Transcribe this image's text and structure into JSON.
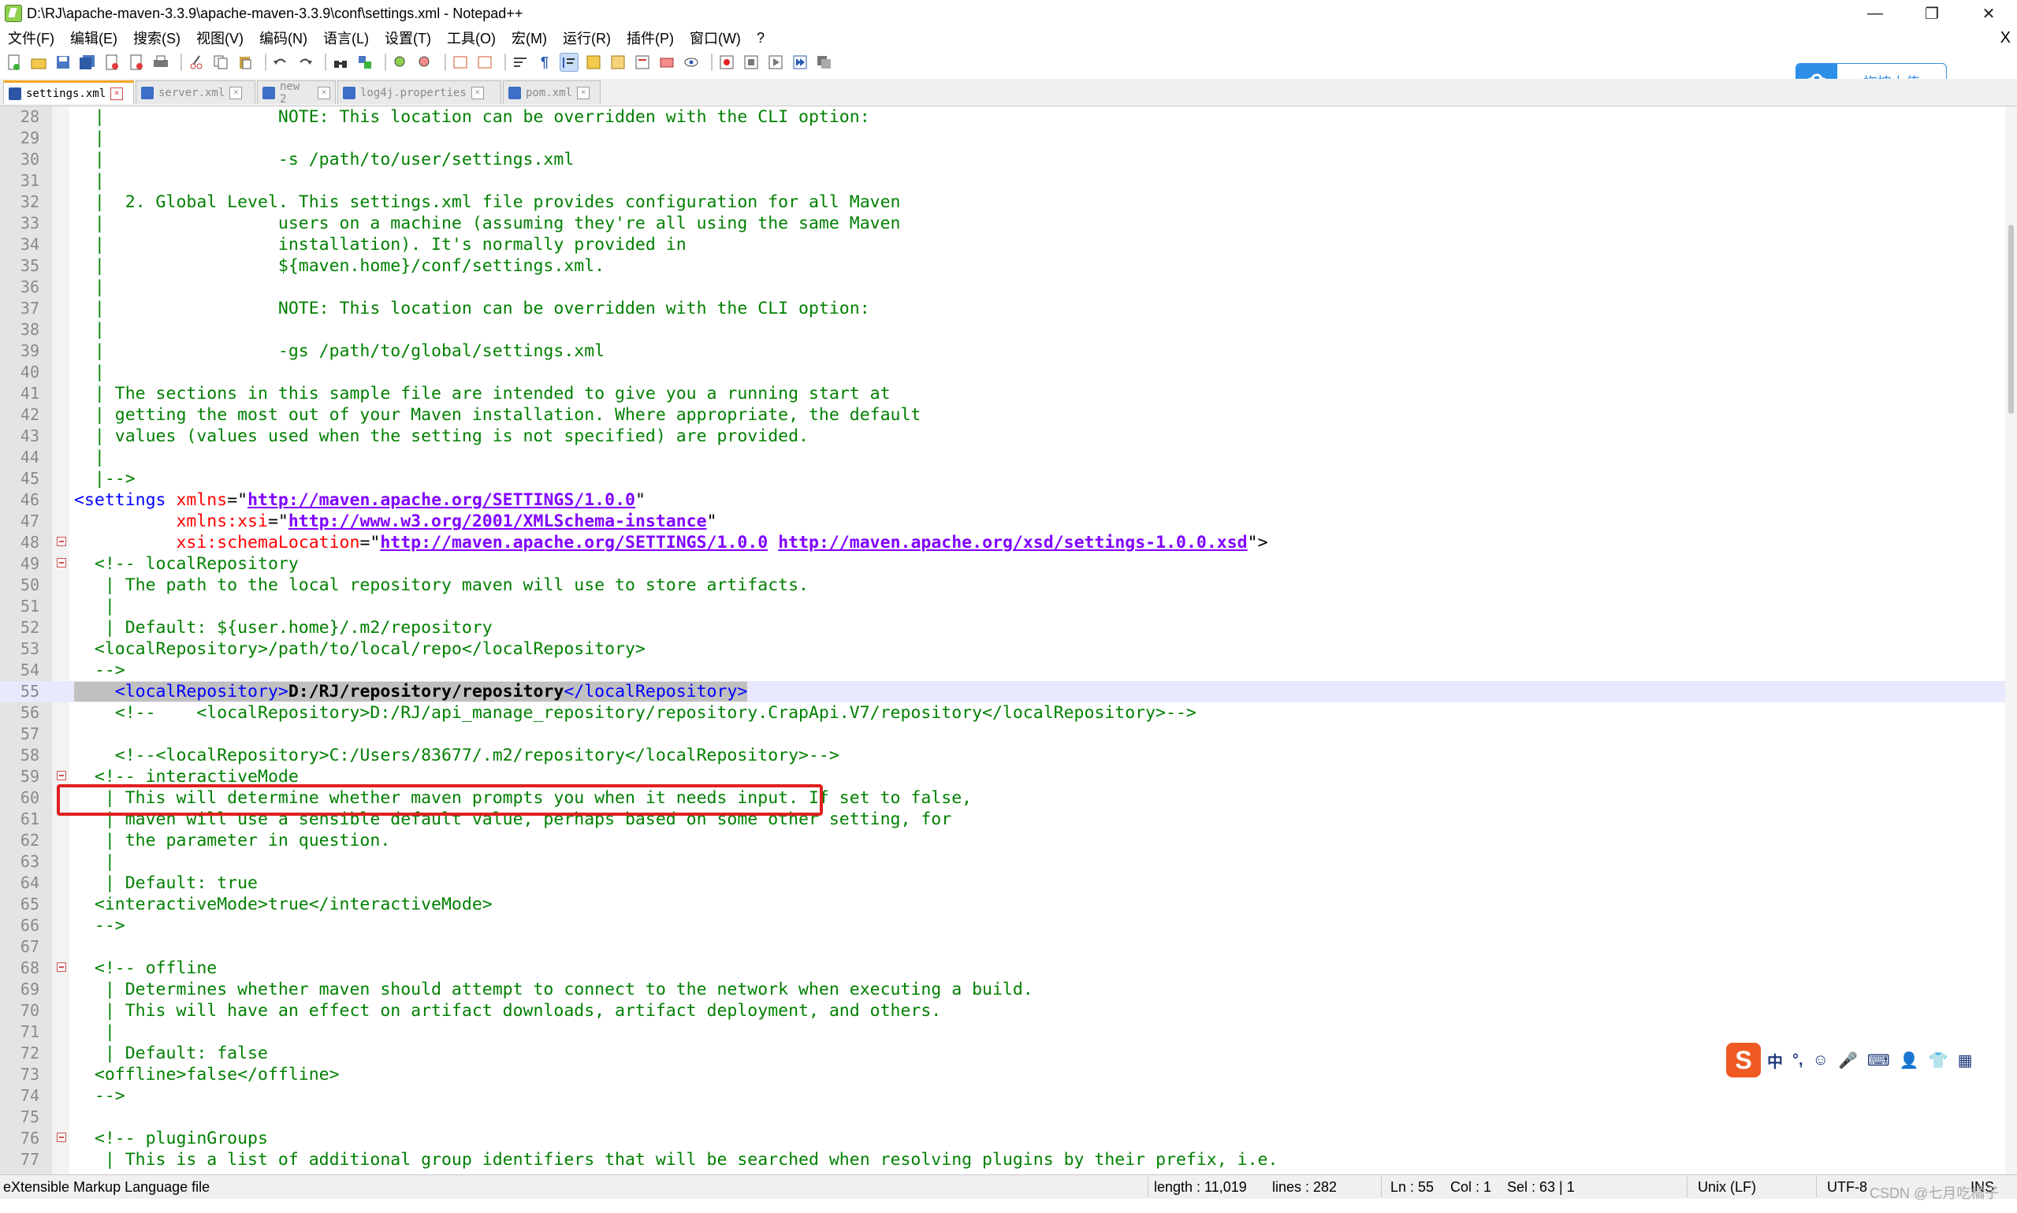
{
  "window": {
    "title": "D:\\RJ\\apache-maven-3.3.9\\apache-maven-3.3.9\\conf\\settings.xml - Notepad++",
    "minimize": "—",
    "maximize": "❐",
    "close": "✕"
  },
  "menu": {
    "items": [
      "文件(F)",
      "编辑(E)",
      "搜索(S)",
      "视图(V)",
      "编码(N)",
      "语言(L)",
      "设置(T)",
      "工具(O)",
      "宏(M)",
      "运行(R)",
      "插件(P)",
      "窗口(W)",
      "?"
    ],
    "close": "X"
  },
  "upload": {
    "label": "拖拽上传"
  },
  "tabs": [
    {
      "label": "settings.xml",
      "active": true
    },
    {
      "label": "server.xml",
      "active": false
    },
    {
      "label": "new 2",
      "active": false
    },
    {
      "label": "log4j.properties",
      "active": false
    },
    {
      "label": "pom.xml",
      "active": false
    }
  ],
  "editor": {
    "lines": [
      {
        "n": "28",
        "text": "  |                 NOTE: This location can be overridden with the CLI option:"
      },
      {
        "n": "29",
        "text": "  |"
      },
      {
        "n": "30",
        "text": "  |                 -s /path/to/user/settings.xml"
      },
      {
        "n": "31",
        "text": "  |"
      },
      {
        "n": "32",
        "text": "  |  2. Global Level. This settings.xml file provides configuration for all Maven"
      },
      {
        "n": "33",
        "text": "  |                 users on a machine (assuming they're all using the same Maven"
      },
      {
        "n": "34",
        "text": "  |                 installation). It's normally provided in"
      },
      {
        "n": "35",
        "text": "  |                 ${maven.home}/conf/settings.xml."
      },
      {
        "n": "36",
        "text": "  |"
      },
      {
        "n": "37",
        "text": "  |                 NOTE: This location can be overridden with the CLI option:"
      },
      {
        "n": "38",
        "text": "  |"
      },
      {
        "n": "39",
        "text": "  |                 -gs /path/to/global/settings.xml"
      },
      {
        "n": "40",
        "text": "  |"
      },
      {
        "n": "41",
        "text": "  | The sections in this sample file are intended to give you a running start at"
      },
      {
        "n": "42",
        "text": "  | getting the most out of your Maven installation. Where appropriate, the default"
      },
      {
        "n": "43",
        "text": "  | values (values used when the setting is not specified) are provided."
      },
      {
        "n": "44",
        "text": "  |"
      },
      {
        "n": "45",
        "text": "  |-->"
      },
      {
        "n": "46",
        "text": ""
      },
      {
        "n": "47",
        "text": ""
      },
      {
        "n": "48",
        "text": ""
      },
      {
        "n": "49",
        "text": "  <!-- localRepository"
      },
      {
        "n": "50",
        "text": "   | The path to the local repository maven will use to store artifacts."
      },
      {
        "n": "51",
        "text": "   |"
      },
      {
        "n": "52",
        "text": "   | Default: ${user.home}/.m2/repository"
      },
      {
        "n": "53",
        "text": "  <localRepository>/path/to/local/repo</localRepository>"
      },
      {
        "n": "54",
        "text": "  -->"
      },
      {
        "n": "55",
        "text": ""
      },
      {
        "n": "56",
        "text": "    <!--    <localRepository>D:/RJ/api_manage_repository/repository.CrapApi.V7/repository</localRepository>-->"
      },
      {
        "n": "57",
        "text": ""
      },
      {
        "n": "58",
        "text": "    <!--<localRepository>C:/Users/83677/.m2/repository</localRepository>-->"
      },
      {
        "n": "59",
        "text": "  <!-- interactiveMode"
      },
      {
        "n": "60",
        "text": "   | This will determine whether maven prompts you when it needs input. If set to false,"
      },
      {
        "n": "61",
        "text": "   | maven will use a sensible default value, perhaps based on some other setting, for"
      },
      {
        "n": "62",
        "text": "   | the parameter in question."
      },
      {
        "n": "63",
        "text": "   |"
      },
      {
        "n": "64",
        "text": "   | Default: true"
      },
      {
        "n": "65",
        "text": "  <interactiveMode>true</interactiveMode>"
      },
      {
        "n": "66",
        "text": "  -->"
      },
      {
        "n": "67",
        "text": ""
      },
      {
        "n": "68",
        "text": "  <!-- offline"
      },
      {
        "n": "69",
        "text": "   | Determines whether maven should attempt to connect to the network when executing a build."
      },
      {
        "n": "70",
        "text": "   | This will have an effect on artifact downloads, artifact deployment, and others."
      },
      {
        "n": "71",
        "text": "   |"
      },
      {
        "n": "72",
        "text": "   | Default: false"
      },
      {
        "n": "73",
        "text": "  <offline>false</offline>"
      },
      {
        "n": "74",
        "text": "  -->"
      },
      {
        "n": "75",
        "text": ""
      },
      {
        "n": "76",
        "text": "  <!-- pluginGroups"
      },
      {
        "n": "77",
        "text": "   | This is a list of additional group identifiers that will be searched when resolving plugins by their prefix, i.e."
      }
    ],
    "line46": {
      "open": "<settings",
      "attr": "xmlns",
      "eq": "=\"",
      "url": "http://maven.apache.org/SETTINGS/1.0.0",
      "close": "\""
    },
    "line47": {
      "attr": "xmlns:xsi",
      "eq": "=\"",
      "url": "http://www.w3.org/2001/XMLSchema-instance",
      "close": "\""
    },
    "line48": {
      "attr": "xsi:schemaLocation",
      "eq": "=\"",
      "url1": "http://maven.apache.org/SETTINGS/1.0.0",
      "url2": "http://maven.apache.org/xsd/settings-1.0.0.xsd",
      "close": "\">"
    },
    "line55": {
      "open_tag": "<localRepository>",
      "value": "D:/RJ/repository/repository",
      "close_tag": "</localRepository>"
    }
  },
  "ime": {
    "logo": "S",
    "items": [
      "中",
      "°,",
      "☺",
      "🎤",
      "⌨",
      "👤",
      "👕",
      "▦"
    ]
  },
  "status": {
    "filetype": "eXtensible Markup Language file",
    "length": "length : 11,019",
    "lines": "lines : 282",
    "ln": "Ln : 55",
    "col": "Col : 1",
    "sel": "Sel : 63 | 1",
    "eol": "Unix (LF)",
    "encoding": "UTF-8",
    "mode": "INS",
    "watermark": "CSDN @七月吃橘子"
  }
}
